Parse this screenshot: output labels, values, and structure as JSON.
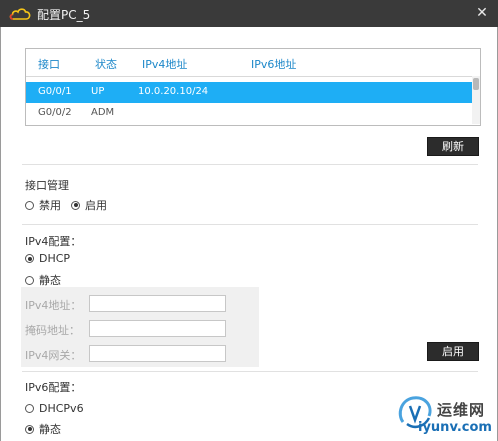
{
  "window": {
    "title": "配置PC_5",
    "close_glyph": "✕"
  },
  "table": {
    "headers": [
      "接口",
      "状态",
      "IPv4地址",
      "IPv6地址"
    ],
    "rows": [
      {
        "interface": "G0/0/1",
        "status": "UP",
        "ipv4": "10.0.20.10/24",
        "ipv6": "",
        "selected": true
      },
      {
        "interface": "G0/0/2",
        "status": "ADM",
        "ipv4": "",
        "ipv6": "",
        "selected": false
      }
    ]
  },
  "refresh_label": "刷新",
  "interface_mgmt": {
    "title": "接口管理",
    "options": [
      {
        "label": "禁用",
        "checked": false
      },
      {
        "label": "启用",
        "checked": true
      }
    ]
  },
  "ipv4": {
    "title": "IPv4配置：",
    "options": [
      {
        "label": "DHCP",
        "checked": true
      },
      {
        "label": "静态",
        "checked": false
      }
    ],
    "fields": {
      "address": {
        "label": "IPv4地址：",
        "value": ""
      },
      "mask": {
        "label": "掩码地址：",
        "value": ""
      },
      "gateway": {
        "label": "IPv4网关：",
        "value": ""
      }
    },
    "apply_label": "启用"
  },
  "ipv6": {
    "title": "IPv6配置：",
    "options": [
      {
        "label": "DHCPv6",
        "checked": false
      },
      {
        "label": "静态",
        "checked": true
      }
    ]
  },
  "watermark": {
    "name": "运维网",
    "url": "iyunv.com"
  },
  "colors": {
    "titlebar": "#3a3a3a",
    "selection": "#1eaef5",
    "header_text": "#1c87c9",
    "button": "#2c2c2c"
  }
}
